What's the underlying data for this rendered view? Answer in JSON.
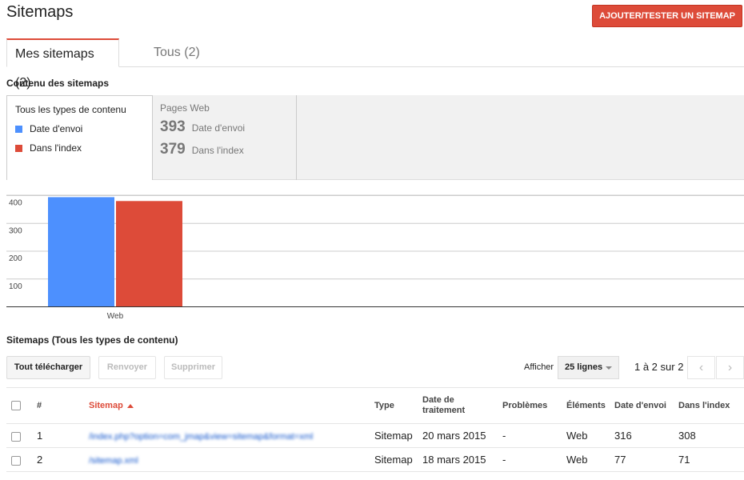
{
  "header": {
    "title": "Sitemaps",
    "add_button": "AJOUTER/TESTER UN SITEMAP"
  },
  "tabs": [
    {
      "label": "Mes sitemaps (2)",
      "active": true
    },
    {
      "label": "Tous (2)",
      "active": false
    }
  ],
  "content_section": {
    "title": "Contenu des sitemaps",
    "legend_title": "Tous les types de contenu",
    "legend": [
      {
        "label": "Date d'envoi",
        "color": "#4d90fe"
      },
      {
        "label": "Dans l'index",
        "color": "#dd4b39"
      }
    ],
    "stats": {
      "title": "Pages Web",
      "rows": [
        {
          "value": "393",
          "label": "Date d'envoi"
        },
        {
          "value": "379",
          "label": "Dans l'index"
        }
      ]
    }
  },
  "chart_data": {
    "type": "bar",
    "categories": [
      "Web"
    ],
    "series": [
      {
        "name": "Date d'envoi",
        "values": [
          393
        ],
        "color": "#4d90fe"
      },
      {
        "name": "Dans l'index",
        "values": [
          379
        ],
        "color": "#dd4b39"
      }
    ],
    "yticks": [
      "100",
      "200",
      "300",
      "400"
    ],
    "ylim": [
      0,
      400
    ],
    "grid": true
  },
  "table_section": {
    "title": "Sitemaps (Tous les types de contenu)",
    "buttons": {
      "download": "Tout télécharger",
      "resubmit": "Renvoyer",
      "delete": "Supprimer"
    },
    "show_label": "Afficher",
    "rows_select": "25 lignes",
    "pager": "1 à 2 sur 2",
    "prev_icon": "‹",
    "next_icon": "›",
    "columns": {
      "num": "#",
      "sitemap": "Sitemap",
      "type": "Type",
      "date_line1": "Date de",
      "date_line2": "traitement",
      "problems": "Problèmes",
      "elements": "Éléments",
      "sent": "Date d'envoi",
      "indexed": "Dans l'index"
    },
    "rows": [
      {
        "num": "1",
        "sitemap": "/index.php?option=com_jmap&view=sitemap&format=xml",
        "type": "Sitemap",
        "date": "20 mars 2015",
        "problems": "-",
        "elements": "Web",
        "sent": "316",
        "indexed": "308"
      },
      {
        "num": "2",
        "sitemap": "/sitemap.xml",
        "type": "Sitemap",
        "date": "18 mars 2015",
        "problems": "-",
        "elements": "Web",
        "sent": "77",
        "indexed": "71"
      }
    ]
  }
}
